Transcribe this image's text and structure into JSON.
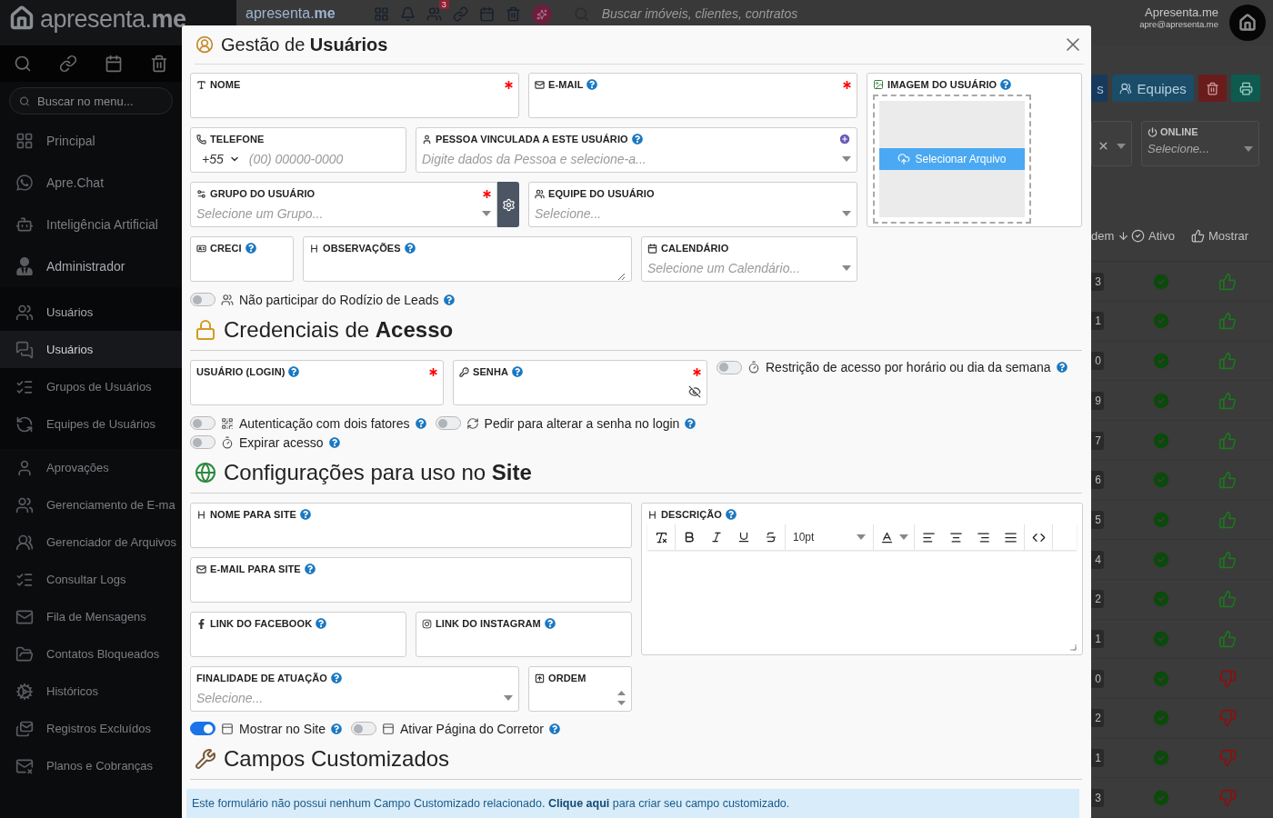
{
  "header": {
    "logo": "apresenta.**me**",
    "small_logo": "apresenta.**me**",
    "notification_badge": "3",
    "search_placeholder": "Buscar imóveis, clientes, contratos",
    "user_name": "Apresenta.me",
    "user_email": "apre@apresenta.me"
  },
  "sidebar": {
    "search_placeholder": "Buscar no menu...",
    "items": [
      {
        "label": "Principal",
        "selected": false
      },
      {
        "label": "Apre.Chat",
        "selected": false
      },
      {
        "label": "Inteligência Artificial",
        "selected": false
      },
      {
        "label": "Administrador",
        "selected": false,
        "expanded": true,
        "children": [
          {
            "label": "Usuários",
            "selected": false,
            "expanded": true,
            "children": [
              {
                "label": "Usuários",
                "selected": true
              },
              {
                "label": "Grupos de Usuários",
                "selected": false
              },
              {
                "label": "Equipes de Usuários",
                "selected": false
              }
            ]
          },
          {
            "label": "Aprovações",
            "selected": false
          },
          {
            "label": "Gerenciamento de E-ma",
            "selected": false
          },
          {
            "label": "Gerenciador de Arquivos",
            "selected": false
          },
          {
            "label": "Consultar Logs",
            "selected": false
          },
          {
            "label": "Fila de Mensagens",
            "selected": false
          },
          {
            "label": "Contatos Bloqueados",
            "selected": false
          },
          {
            "label": "Históricos",
            "selected": false
          },
          {
            "label": "Registros Excluídos",
            "selected": false
          },
          {
            "label": "Planos e Cobranças",
            "selected": false
          }
        ]
      }
    ]
  },
  "background": {
    "buttons": [
      {
        "kind": "partial",
        "label": "s"
      },
      {
        "kind": "teams",
        "label": "Equipes"
      },
      {
        "kind": "delete"
      },
      {
        "kind": "print"
      }
    ],
    "filters": [
      {
        "kind": "clearable"
      },
      {
        "kind": "select",
        "label": "ONLINE",
        "placeholder": "Selecione..."
      }
    ],
    "columns": [
      {
        "label": "dem"
      },
      {
        "label": "Ativo"
      },
      {
        "label": "Mostrar"
      }
    ],
    "rows": [
      {
        "order": "3",
        "active": true,
        "shown": true
      },
      {
        "order": "1",
        "active": true,
        "shown": true
      },
      {
        "order": "0",
        "active": true,
        "shown": true
      },
      {
        "order": "9",
        "active": true,
        "shown": true
      },
      {
        "order": "7",
        "active": true,
        "shown": true
      },
      {
        "order": "6",
        "active": true,
        "shown": true
      },
      {
        "order": "5",
        "active": true,
        "shown": true
      },
      {
        "order": "4",
        "active": true,
        "shown": true
      },
      {
        "order": "2",
        "active": true,
        "shown": true
      },
      {
        "order": "1",
        "active": true,
        "shown": true
      },
      {
        "order": "0",
        "active": true,
        "shown": false
      },
      {
        "order": "2",
        "active": true,
        "shown": false
      },
      {
        "order": "1",
        "active": true,
        "shown": false
      },
      {
        "order": "3",
        "active": true,
        "shown": false
      }
    ]
  },
  "modal": {
    "title": "Gestão de **Usuários**",
    "general_rows": [
      [
        {
          "kind": "text",
          "label": "NOME",
          "required": true,
          "help": false
        },
        {
          "kind": "text",
          "label": "E-MAIL",
          "required": true,
          "help": true
        }
      ],
      [
        {
          "kind": "phone",
          "label": "TELEFONE",
          "required": false,
          "help": false,
          "prefix": "+55",
          "placeholder": "(00) 00000-0000"
        },
        {
          "kind": "select",
          "label": "PESSOA VINCULADA A ESTE USUÁRIO",
          "required": false,
          "help": true,
          "add": true,
          "placeholder": "Digite dados da Pessoa e selecione-a..."
        }
      ],
      [
        {
          "kind": "select",
          "label": "GRUPO DO USUÁRIO",
          "required": true,
          "help": false,
          "settings": true,
          "placeholder": "Selecione um Grupo..."
        },
        {
          "kind": "select",
          "label": "EQUIPE DO USUÁRIO",
          "required": false,
          "help": false,
          "placeholder": "Selecione..."
        }
      ],
      [
        {
          "kind": "text",
          "label": "CRECI",
          "required": false,
          "help": true
        },
        {
          "kind": "textarea",
          "label": "OBSERVAÇÕES",
          "required": false,
          "help": true
        },
        {
          "kind": "select",
          "label": "CALENDÁRIO",
          "required": false,
          "help": false,
          "placeholder": "Selecione um Calendário..."
        }
      ]
    ],
    "image_field": {
      "label": "IMAGEM DO USUÁRIO",
      "help": true,
      "button": "Selecionar Arquivo"
    },
    "general_toggles": [
      {
        "label": "Não participar do Rodízio de Leads",
        "on": false
      }
    ],
    "credentials": {
      "title": "Credenciais de **Acesso**",
      "fields": [
        {
          "kind": "text",
          "label": "USUÁRIO (LOGIN)",
          "required": true,
          "help": true
        },
        {
          "kind": "password",
          "label": "SENHA",
          "required": true,
          "help": true
        }
      ],
      "side_toggle": {
        "label": "Restrição de acesso por horário ou dia da semana",
        "on": false
      },
      "toggle_rows": [
        [
          {
            "label": "Autenticação com dois fatores",
            "on": false
          },
          {
            "label": "Pedir para alterar a senha no login",
            "on": false
          }
        ],
        [
          {
            "label": "Expirar acesso",
            "on": false
          }
        ]
      ]
    },
    "site": {
      "title": "Configurações para uso no **Site**",
      "rows": [
        [
          {
            "kind": "text",
            "label": "NOME PARA SITE",
            "required": false,
            "help": true
          }
        ],
        [
          {
            "kind": "text",
            "label": "E-MAIL PARA SITE",
            "required": false,
            "help": true
          }
        ],
        [
          {
            "kind": "text",
            "label": "LINK DO FACEBOOK",
            "required": false,
            "help": true
          },
          {
            "kind": "text",
            "label": "LINK DO INSTAGRAM",
            "required": false,
            "help": true
          }
        ],
        [
          {
            "kind": "select",
            "label": "FINALIDADE DE ATUAÇÃO",
            "required": false,
            "help": true,
            "placeholder": "Selecione..."
          },
          {
            "kind": "number",
            "label": "ORDEM",
            "required": false,
            "help": false
          }
        ]
      ],
      "description": {
        "label": "DESCRIÇÃO",
        "help": true,
        "font_size": "10pt"
      },
      "toggles": [
        {
          "label": "Mostrar no Site",
          "on": true
        },
        {
          "label": "Ativar Página do Corretor",
          "on": false
        }
      ]
    },
    "custom": {
      "title": "Campos Customizados",
      "info_before": "Este formulário não possui nenhum Campo Customizado relacionado.",
      "info_link": "Clique aqui",
      "info_after": "para criar seu campo customizado."
    }
  }
}
